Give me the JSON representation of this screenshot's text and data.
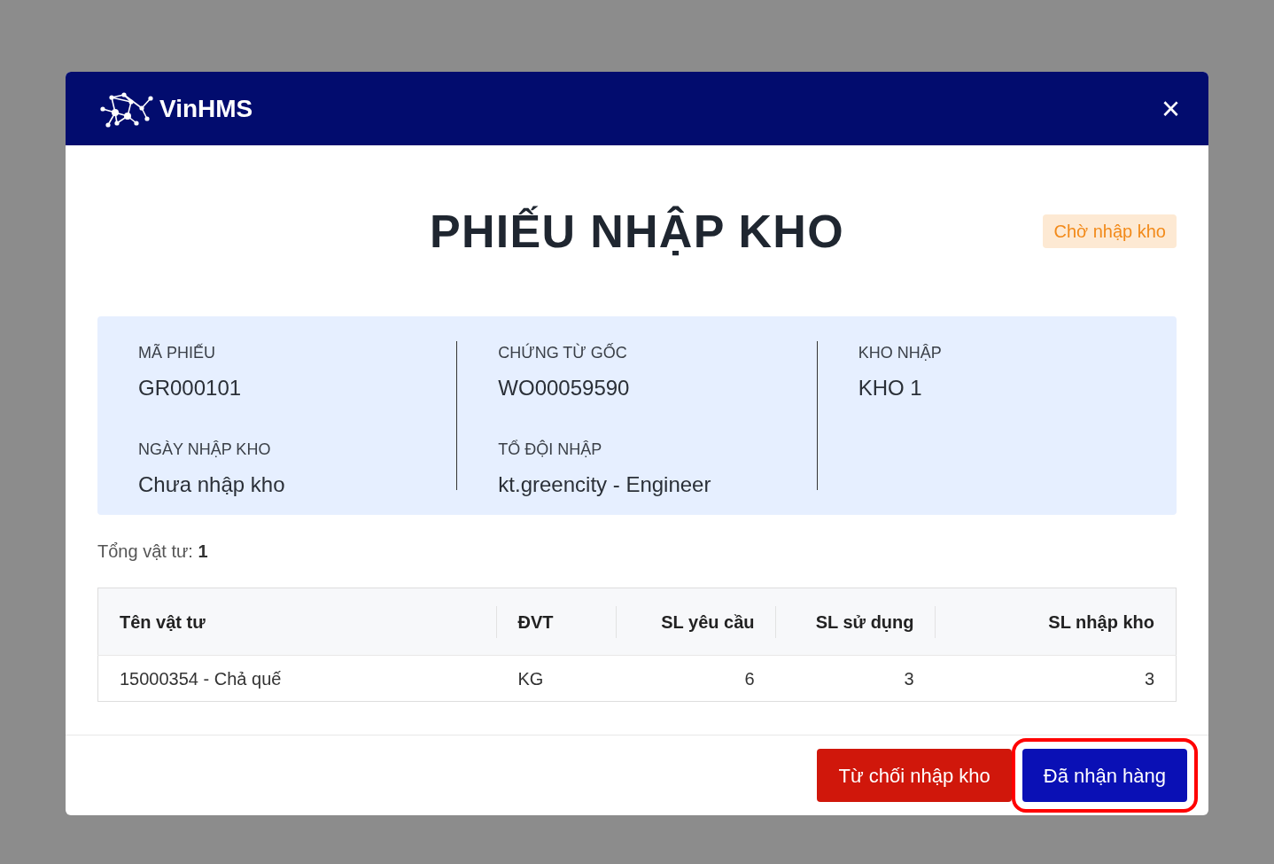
{
  "modal": {
    "brand": "VinHMS",
    "close": "×"
  },
  "title": "PHIẾU NHẬP KHO",
  "status": {
    "label": "Chờ nhập kho",
    "kind": "pending"
  },
  "info": [
    {
      "label": "MÃ PHIẾU",
      "value": "GR000101"
    },
    {
      "label": "CHỨNG TỪ GỐC",
      "value": "WO00059590"
    },
    {
      "label": "KHO NHẬP",
      "value": "KHO 1"
    },
    {
      "label": "NGÀY NHẬP KHO",
      "value": "Chưa nhập kho"
    },
    {
      "label": "TỔ ĐỘI NHẬP",
      "value": "kt.greencity - Engineer"
    }
  ],
  "total": "Tổng vật tư: **1**",
  "table": {
    "columns": [
      "Tên vật tư",
      "ĐVT",
      "SL yêu cầu",
      "SL sử dụng",
      "SL nhập kho"
    ],
    "rows": [
      [
        "15000354 - Chả quế",
        "KG",
        "6",
        "3",
        "3"
      ]
    ]
  },
  "buttons": [
    {
      "label": "Từ chối nhập kho",
      "kind": "danger",
      "highlighted": false
    },
    {
      "label": "Đã nhận hàng",
      "kind": "primary",
      "highlighted": true
    }
  ]
}
